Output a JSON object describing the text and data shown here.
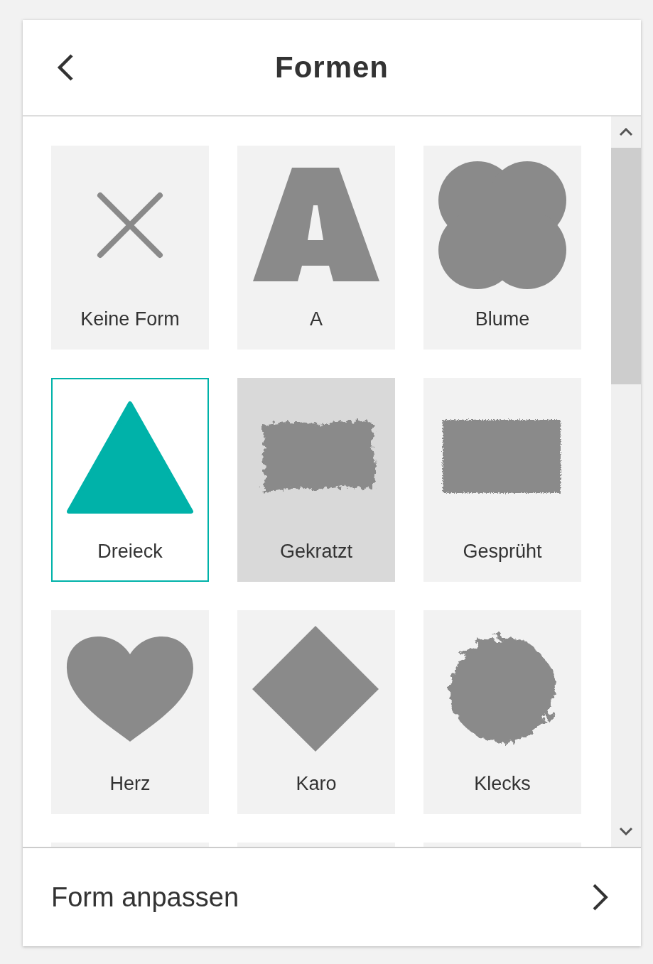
{
  "header": {
    "title": "Formen"
  },
  "shapes": [
    {
      "label": "Keine Form",
      "kind": "none",
      "selected": false,
      "hovered": false
    },
    {
      "label": "A",
      "kind": "letter",
      "selected": false,
      "hovered": false
    },
    {
      "label": "Blume",
      "kind": "flower",
      "selected": false,
      "hovered": false
    },
    {
      "label": "Dreieck",
      "kind": "triangle",
      "selected": true,
      "hovered": false
    },
    {
      "label": "Gekratzt",
      "kind": "scratched",
      "selected": false,
      "hovered": true
    },
    {
      "label": "Gesprüht",
      "kind": "sprayed",
      "selected": false,
      "hovered": false
    },
    {
      "label": "Herz",
      "kind": "heart",
      "selected": false,
      "hovered": false
    },
    {
      "label": "Karo",
      "kind": "diamond",
      "selected": false,
      "hovered": false
    },
    {
      "label": "Klecks",
      "kind": "blot",
      "selected": false,
      "hovered": false
    },
    {
      "selected": false,
      "hovered": false
    },
    {
      "selected": false,
      "hovered": false
    },
    {
      "selected": false,
      "hovered": false
    }
  ],
  "footer": {
    "label": "Form anpassen"
  }
}
